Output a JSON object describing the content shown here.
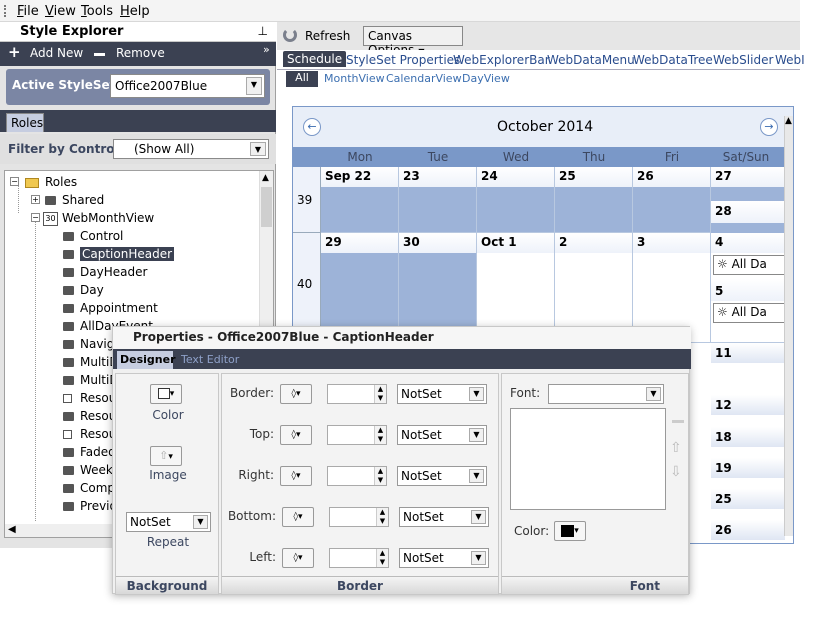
{
  "menu": {
    "items": [
      {
        "label": "File",
        "key": "F",
        "rest": "ile"
      },
      {
        "label": "View",
        "key": "V",
        "rest": "iew"
      },
      {
        "label": "Tools",
        "key": "T",
        "rest": "ools"
      },
      {
        "label": "Help",
        "key": "H",
        "rest": "elp"
      }
    ]
  },
  "style_explorer": {
    "title": "Style Explorer",
    "pin_glyph": "⊥",
    "add_label": "Add New",
    "remove_label": "Remove",
    "overflow_glyph": "»",
    "active_styleset_label": "Active StyleSet:",
    "active_styleset_value": "Office2007Blue",
    "roles_tab": "Roles",
    "filter_label": "Filter by Control:",
    "filter_value": "(Show All)",
    "tree": [
      {
        "label": "Roles",
        "exp": "−"
      },
      {
        "label": "Shared",
        "exp": "+"
      },
      {
        "label": "WebMonthView",
        "exp": "−",
        "badge": "30"
      },
      {
        "label": "Control"
      },
      {
        "label": "CaptionHeader",
        "selected": true
      },
      {
        "label": "DayHeader"
      },
      {
        "label": "Day"
      },
      {
        "label": "Appointment"
      },
      {
        "label": "AllDayEvent"
      },
      {
        "label": "Navig"
      },
      {
        "label": "MultiD"
      },
      {
        "label": "MultiD"
      },
      {
        "label": "Resou",
        "check": true
      },
      {
        "label": "Resou"
      },
      {
        "label": "Resou",
        "check": true
      },
      {
        "label": "Faded"
      },
      {
        "label": "Weekl"
      },
      {
        "label": "Comp"
      },
      {
        "label": "Previo"
      }
    ]
  },
  "toolbar": {
    "refresh_label": "Refresh",
    "canvas_options_label": "Canvas Options"
  },
  "control_tabs": [
    "Schedule",
    "StyleSet Properties",
    "WebExplorerBar",
    "WebDataMenu",
    "WebDataTree",
    "WebSlider",
    "WebI"
  ],
  "sub_tabs": [
    "All",
    "MonthView",
    "CalendarView",
    "DayView"
  ],
  "calendar": {
    "title": "October 2014",
    "prev_glyph": "←",
    "next_glyph": "→",
    "day_names": [
      "Mon",
      "Tue",
      "Wed",
      "Thu",
      "Fri",
      "Sat/Sun"
    ],
    "weeks": [
      {
        "num": "39",
        "days": [
          "Sep 22",
          "23",
          "24",
          "25",
          "26"
        ],
        "sat": "27",
        "sun": "28"
      },
      {
        "num": "40",
        "days": [
          "29",
          "30",
          "Oct 1",
          "2",
          "3"
        ],
        "sat": "4",
        "sun": "5",
        "event": "All Da"
      }
    ],
    "more_dates": [
      "11",
      "12",
      "18",
      "19",
      "25",
      "26"
    ]
  },
  "properties": {
    "title": "Properties - Office2007Blue - CaptionHeader",
    "tab_designer": "Designer",
    "tab_text_editor": "Text Editor",
    "color_label": "Color",
    "image_label": "Image",
    "repeat_value": "NotSet",
    "repeat_label": "Repeat",
    "background_footer": "Background",
    "border_labels": [
      "Border:",
      "Top:",
      "Right:",
      "Bottom:",
      "Left:"
    ],
    "border_style_value": "NotSet",
    "border_footer": "Border",
    "font_label": "Font:",
    "font_color_label": "Color:",
    "font_footer": "Font",
    "font_color": "#000000"
  }
}
